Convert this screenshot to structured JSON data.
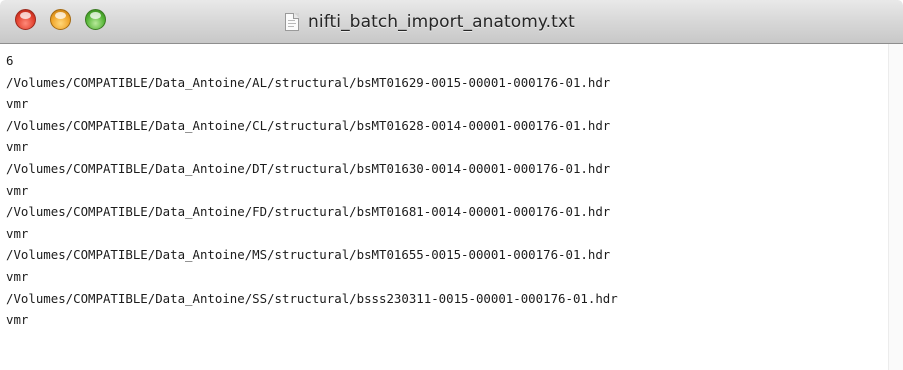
{
  "window": {
    "title": "nifti_batch_import_anatomy.txt",
    "title_icon": "text-document-icon",
    "controls": [
      "close-button",
      "minimize-button",
      "zoom-button"
    ]
  },
  "document": {
    "lines": [
      "6",
      "/Volumes/COMPATIBLE/Data_Antoine/AL/structural/bsMT01629-0015-00001-000176-01.hdr",
      "vmr",
      "/Volumes/COMPATIBLE/Data_Antoine/CL/structural/bsMT01628-0014-00001-000176-01.hdr",
      "vmr",
      "/Volumes/COMPATIBLE/Data_Antoine/DT/structural/bsMT01630-0014-00001-000176-01.hdr",
      "vmr",
      "/Volumes/COMPATIBLE/Data_Antoine/FD/structural/bsMT01681-0014-00001-000176-01.hdr",
      "vmr",
      "/Volumes/COMPATIBLE/Data_Antoine/MS/structural/bsMT01655-0015-00001-000176-01.hdr",
      "vmr",
      "/Volumes/COMPATIBLE/Data_Antoine/SS/structural/bsss230311-0015-00001-000176-01.hdr",
      "vmr"
    ]
  }
}
